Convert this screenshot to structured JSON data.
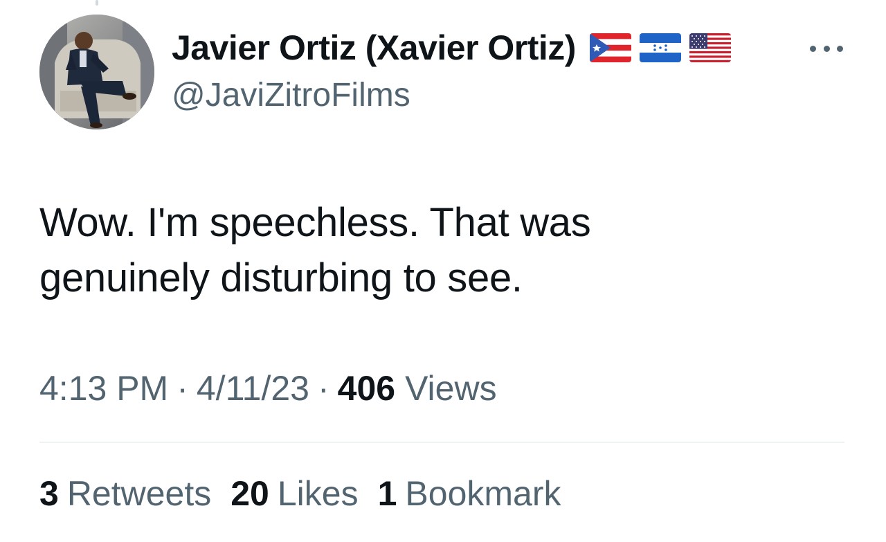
{
  "author": {
    "display_name": "Javier Ortiz (Xavier Ortiz)",
    "handle": "@JaviZitroFilms",
    "flags": [
      "puerto-rico-flag",
      "honduras-flag",
      "united-states-flag"
    ]
  },
  "tweet": {
    "text_line1": "Wow. I'm speechless. That was",
    "text_line2": "genuinely disturbing to see.",
    "time": "4:13 PM",
    "date": "4/11/23",
    "separator": "·",
    "views_count": "406",
    "views_label": "Views"
  },
  "stats": {
    "retweets_count": "3",
    "retweets_label": "Retweets",
    "likes_count": "20",
    "likes_label": "Likes",
    "bookmarks_count": "1",
    "bookmarks_label": "Bookmark"
  },
  "icons": {
    "more": "more-options-icon"
  },
  "colors": {
    "primary_text": "#0f1419",
    "secondary_text": "#536471",
    "divider": "#eff3f4",
    "background": "#ffffff"
  }
}
